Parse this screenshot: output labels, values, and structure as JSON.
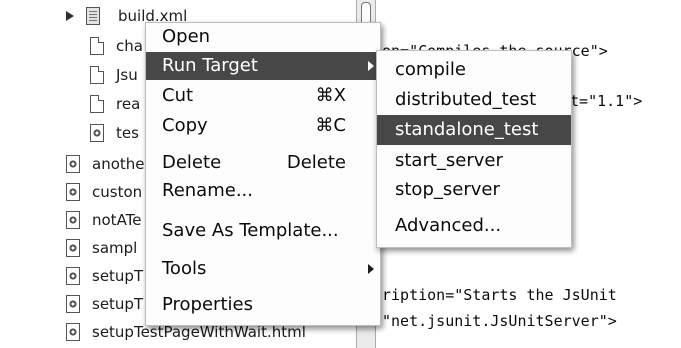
{
  "tree": {
    "build_file": "build.xml",
    "child_labels": [
      "cha",
      "Jsu",
      "rea",
      "tes"
    ],
    "files": [
      "anothe",
      "custon",
      "notATe",
      "sampl",
      "setupT",
      "setupT",
      "setupTestPageWithWait.html"
    ]
  },
  "editor": {
    "lines": [
      "on=\"Compiles the source\">",
      "et=\"1.1\">",
      "ription=\"Starts the JsUnit",
      "\"net.jsunit.JsUnitServer\">"
    ]
  },
  "context_menu": {
    "open": "Open",
    "run_target": "Run Target",
    "cut": "Cut",
    "cut_shortcut": "⌘X",
    "copy": "Copy",
    "copy_shortcut": "⌘C",
    "delete": "Delete",
    "delete_shortcut": "Delete",
    "rename": "Rename...",
    "save_as_template": "Save As Template...",
    "tools": "Tools",
    "properties": "Properties"
  },
  "submenu": {
    "items": [
      "compile",
      "distributed_test",
      "standalone_test",
      "start_server",
      "stop_server",
      "Advanced..."
    ],
    "selected": "standalone_test"
  },
  "colors": {
    "selection": "#4a4a4a",
    "menu_background": "#f7f7f7"
  }
}
